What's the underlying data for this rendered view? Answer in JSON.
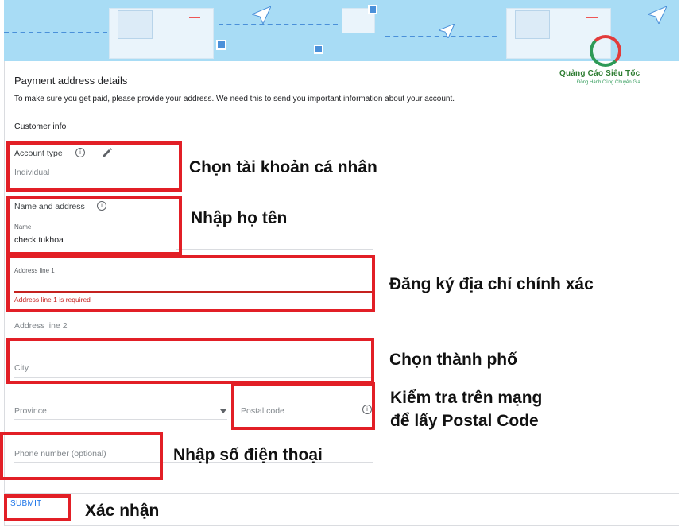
{
  "logo": {
    "name": "Quảng Cáo Siêu Tốc",
    "tagline": "Đồng Hành Cùng Chuyên Gia"
  },
  "page": {
    "title": "Payment address details",
    "description": "To make sure you get paid, please provide your address. We need this to send you important information about your account.",
    "section_label": "Customer info"
  },
  "account_type": {
    "label": "Account type",
    "value": "Individual"
  },
  "name_address": {
    "label": "Name and address",
    "name_label": "Name",
    "name_value": "check tukhoa"
  },
  "address_line_1": {
    "label": "Address line 1",
    "value": "",
    "error": "Address line 1 is required"
  },
  "address_line_2": {
    "placeholder": "Address line 2"
  },
  "city": {
    "placeholder": "City"
  },
  "province": {
    "placeholder": "Province"
  },
  "postal_code": {
    "placeholder": "Postal code"
  },
  "phone": {
    "placeholder": "Phone number (optional)"
  },
  "submit": {
    "label": "SUBMIT"
  },
  "annotations": {
    "account_type": "Chọn tài khoản cá nhân",
    "name": "Nhập họ tên",
    "address": "Đăng ký địa chỉ chính xác",
    "city": "Chọn thành phố",
    "postal_line1": "Kiểm tra trên mạng",
    "postal_line2": "để lấy Postal Code",
    "phone": "Nhập số điện thoại",
    "submit": "Xác nhận"
  },
  "colors": {
    "highlight_red": "#e21f26",
    "link_blue": "#1a73e8",
    "error_red": "#c5221f",
    "banner_blue": "#a8dcf5"
  }
}
